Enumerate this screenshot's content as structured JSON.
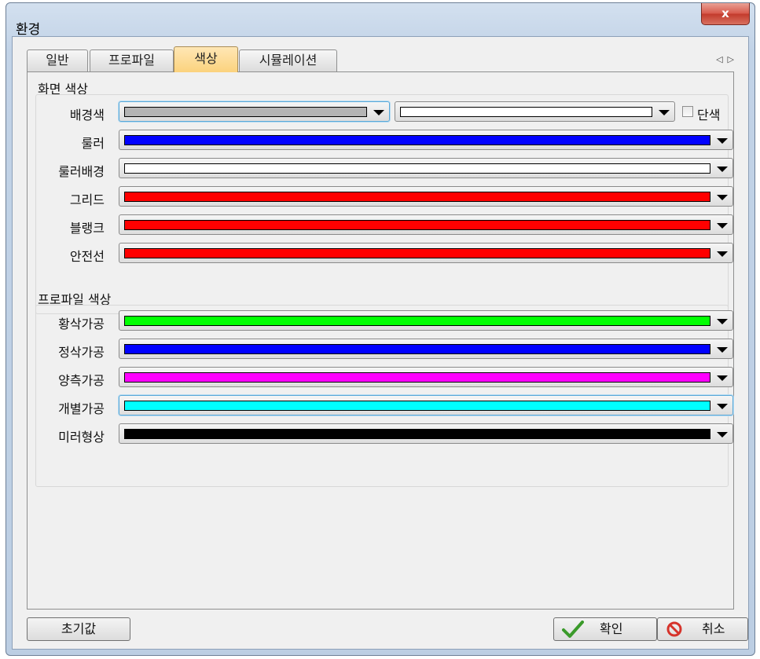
{
  "window": {
    "title": "환경",
    "close_label": "x"
  },
  "tabs": [
    {
      "label": "일반",
      "active": false
    },
    {
      "label": "프로파일",
      "active": false
    },
    {
      "label": "색상",
      "active": true
    },
    {
      "label": "시뮬레이션",
      "active": false
    }
  ],
  "tab_nav": {
    "prev_icon": "◁",
    "next_icon": "▷"
  },
  "screen_colors": {
    "title": "화면 색상",
    "background": {
      "label": "배경색",
      "color1": "#b4b4b4",
      "color2": "#ffffff",
      "solid_label": "단색",
      "solid_checked": false
    },
    "rows": [
      {
        "label": "룰러",
        "color": "#0000ff"
      },
      {
        "label": "룰러배경",
        "color": "#ffffff"
      },
      {
        "label": "그리드",
        "color": "#ff0000"
      },
      {
        "label": "블랭크",
        "color": "#ff0000"
      },
      {
        "label": "안전선",
        "color": "#ff0000"
      }
    ]
  },
  "profile_colors": {
    "title": "프로파일 색상",
    "rows": [
      {
        "label": "황삭가공",
        "color": "#00ff00"
      },
      {
        "label": "정삭가공",
        "color": "#0000ff"
      },
      {
        "label": "양측가공",
        "color": "#ff00ff"
      },
      {
        "label": "개별가공",
        "color": "#00ffff"
      },
      {
        "label": "미러형상",
        "color": "#000000"
      }
    ]
  },
  "buttons": {
    "reset": "초기값",
    "ok": "확인",
    "cancel": "취소"
  },
  "icons": {
    "close": "close-icon",
    "dropdown": "chevron-down-icon",
    "ok": "checkmark-icon",
    "cancel": "no-entry-icon"
  }
}
